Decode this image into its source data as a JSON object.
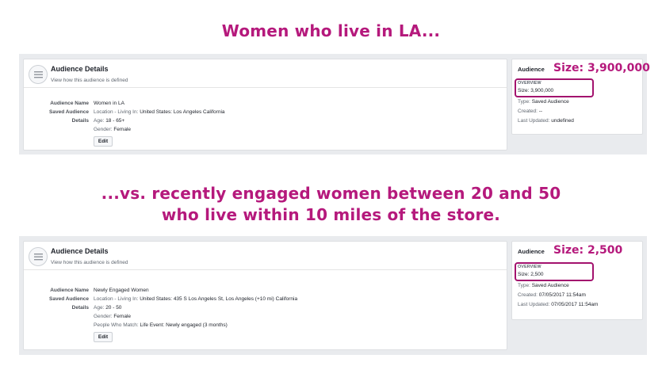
{
  "headline_1": "Women who live in LA...",
  "headline_2": [
    "...vs. recently engaged women between 20 and 50",
    "who live within 10 miles of the store."
  ],
  "brand_color": "#b5197c",
  "panels": [
    {
      "details": {
        "title": "Audience Details",
        "subtitle": "View how this audience is defined",
        "name_label": "Audience Name",
        "name_value": "Women in LA",
        "saved_label_1": "Saved Audience",
        "saved_label_2": "Details",
        "location_prefix": "Location - Living In:",
        "location_value": "United States: Los Angeles California",
        "age_prefix": "Age:",
        "age_value": "18 - 65+",
        "gender_prefix": "Gender:",
        "gender_value": "Female",
        "edit": "Edit"
      },
      "side": {
        "audience_label": "Audience",
        "size_highlight": "Size: 3,900,000",
        "overview": "OVERVIEW",
        "size_line": "Size: 3,900,000",
        "type_prefix": "Type:",
        "type_value": "Saved Audience",
        "created_prefix": "Created:",
        "created_value": "--",
        "updated_prefix": "Last Updated:",
        "updated_value": "undefined"
      }
    },
    {
      "details": {
        "title": "Audience Details",
        "subtitle": "View how this audience is defined",
        "name_label": "Audience Name",
        "name_value": "Newly Engaged Women",
        "saved_label_1": "Saved Audience",
        "saved_label_2": "Details",
        "location_prefix": "Location - Living In:",
        "location_value": "United States: 435 S Los Angeles St, Los Angeles (+10 mi) California",
        "age_prefix": "Age:",
        "age_value": "20 - 50",
        "gender_prefix": "Gender:",
        "gender_value": "Female",
        "match_prefix": "People Who Match:",
        "match_value": "Life Event: Newly engaged (3 months)",
        "edit": "Edit"
      },
      "side": {
        "audience_label": "Audience",
        "size_highlight": "Size: 2,500",
        "overview": "OVERVIEW",
        "size_line": "Size: 2,500",
        "type_prefix": "Type:",
        "type_value": "Saved Audience",
        "created_prefix": "Created:",
        "created_value": "07/05/2017 11:54am",
        "updated_prefix": "Last Updated:",
        "updated_value": "07/05/2017 11:54am"
      }
    }
  ]
}
